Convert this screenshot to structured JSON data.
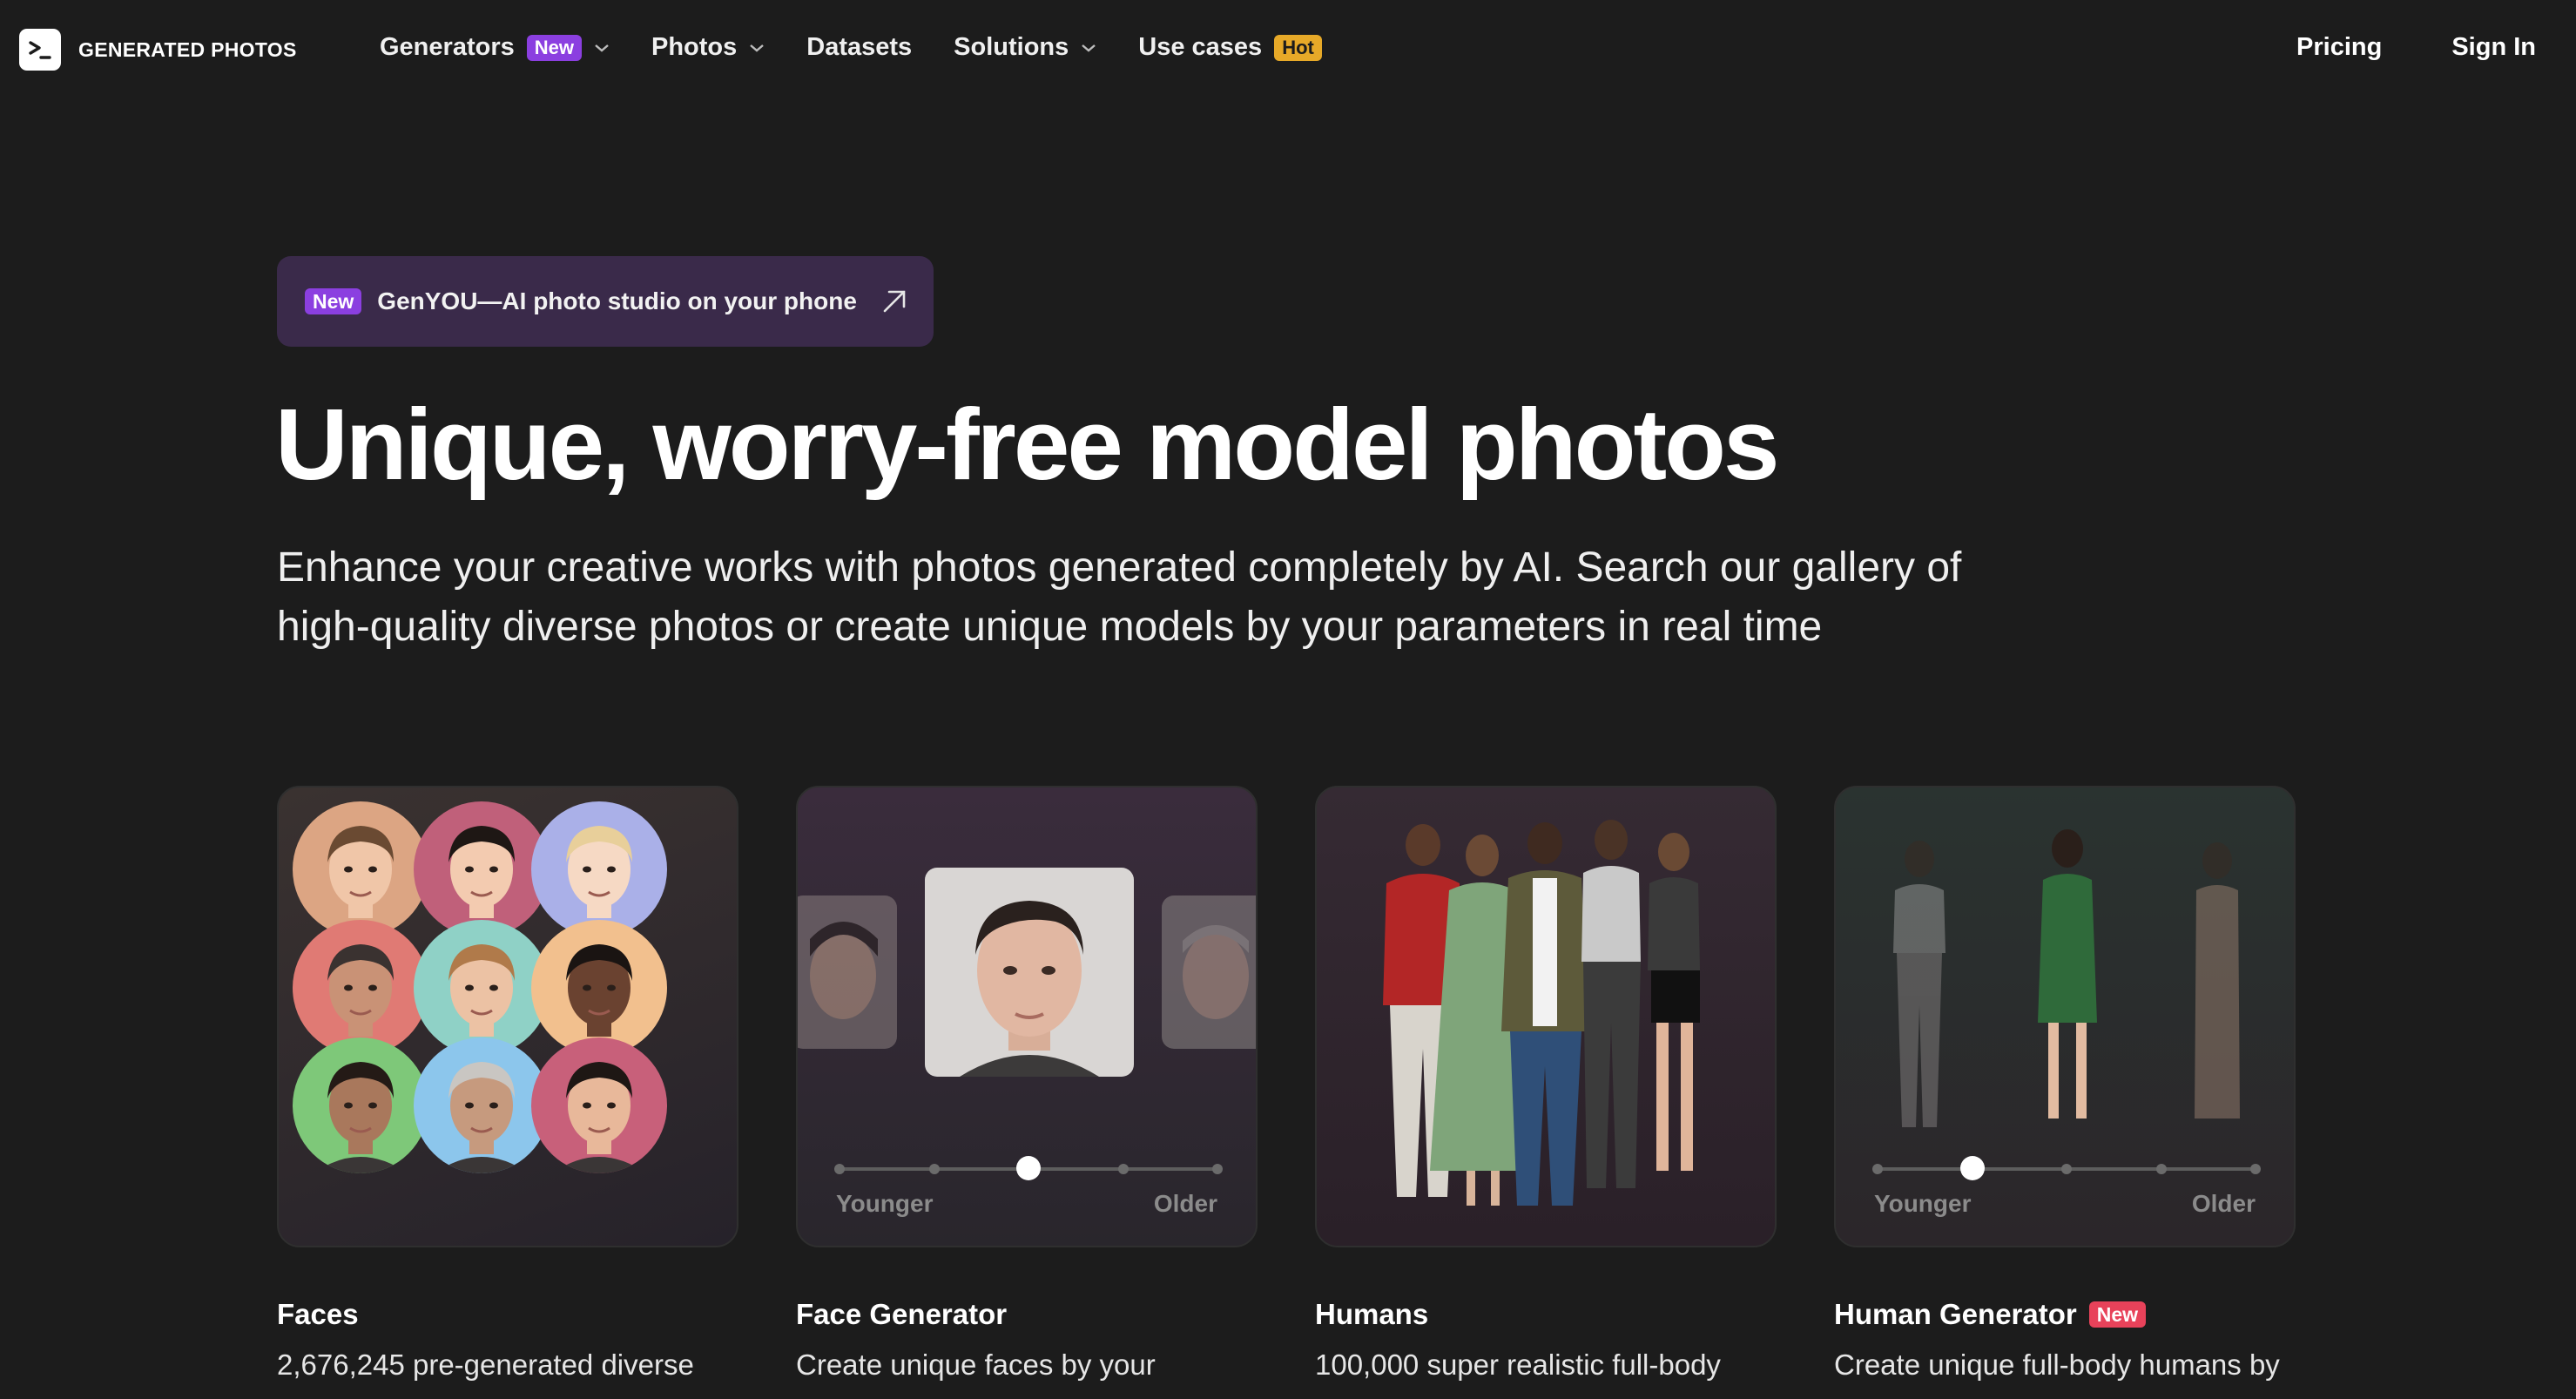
{
  "brand": {
    "name": "GENERATED PHOTOS"
  },
  "nav": {
    "items": [
      {
        "label": "Generators",
        "badge": "New",
        "has_dropdown": true
      },
      {
        "label": "Photos",
        "badge": "",
        "has_dropdown": true
      },
      {
        "label": "Datasets",
        "badge": "",
        "has_dropdown": false
      },
      {
        "label": "Solutions",
        "badge": "",
        "has_dropdown": true
      },
      {
        "label": "Use cases",
        "badge": "Hot",
        "has_dropdown": false
      }
    ],
    "pricing": "Pricing",
    "sign_in": "Sign In"
  },
  "promo": {
    "badge": "New",
    "text": "GenYOU—AI photo studio on your phone"
  },
  "hero": {
    "title": "Unique, worry-free model photos",
    "subtitle_line1": "Enhance your creative works with photos generated completely by AI. Search our gallery of",
    "subtitle_line2": "high-quality diverse photos or create unique models by your parameters in real time"
  },
  "cards": [
    {
      "title": "Faces",
      "badge": "",
      "desc": "2,676,245 pre-generated diverse"
    },
    {
      "title": "Face Generator",
      "badge": "",
      "desc": "Create unique faces by your",
      "slider": {
        "min_label": "Younger",
        "max_label": "Older",
        "level": 0.5
      }
    },
    {
      "title": "Humans",
      "badge": "",
      "desc": "100,000 super realistic full-body"
    },
    {
      "title": "Human Generator",
      "badge": "New",
      "desc": "Create unique full-body humans by",
      "slider": {
        "min_label": "Younger",
        "max_label": "Older",
        "level": 0.25
      }
    }
  ],
  "colors": {
    "background": "#1c1c1c",
    "badge_new_purple": "#8b3fe0",
    "badge_hot_yellow": "#e7a928",
    "badge_new_red": "#e8425a",
    "promo_bg": "#3a2a4a"
  }
}
